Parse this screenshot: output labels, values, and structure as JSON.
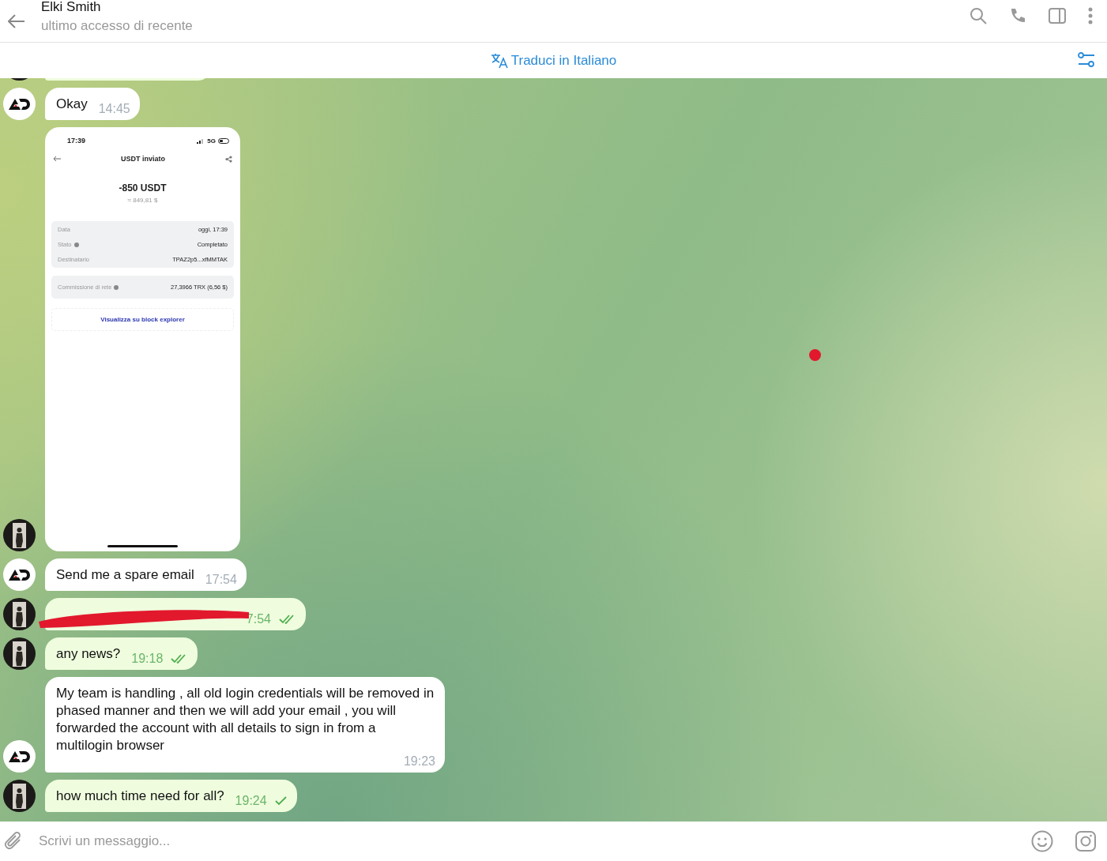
{
  "header": {
    "title": "Elki Smith",
    "status": "ultimo accesso di recente"
  },
  "translate_bar": {
    "label": "Traduci in Italiano"
  },
  "messages": [
    {
      "kind": "fragment",
      "outgoing": true
    },
    {
      "kind": "text",
      "outgoing": false,
      "text": "Okay",
      "time": "14:45"
    },
    {
      "kind": "screenshot",
      "outgoing": true,
      "screenshot": {
        "clock": "17:39",
        "network": "5G",
        "title": "USDT inviato",
        "amount": "-850 USDT",
        "fiat": "≈ 849,81 $",
        "details": [
          {
            "label": "Data",
            "value": "oggi, 17:39",
            "info": false
          },
          {
            "label": "Stato",
            "value": "Completato",
            "info": true
          },
          {
            "label": "Destinatario",
            "value": "TPAZ2p5...xfMMTAK",
            "info": false
          }
        ],
        "fee": {
          "label": "Commissione di rete",
          "value": "27,3966 TRX (6,56 $)",
          "info": true
        },
        "link": "Visualizza su block explorer"
      }
    },
    {
      "kind": "text",
      "outgoing": false,
      "text": "Send me a spare email",
      "time": "17:54"
    },
    {
      "kind": "redacted",
      "outgoing": true,
      "time": "7:54",
      "read": true
    },
    {
      "kind": "text",
      "outgoing": true,
      "text": "any news?",
      "time": "19:18",
      "read": true
    },
    {
      "kind": "text",
      "outgoing": false,
      "text": "My team is handling , all old login credentials will be removed in phased manner and then we will add your email , you will forwarded the account with all details to sign in from a multilogin browser",
      "time": "19:23"
    },
    {
      "kind": "text",
      "outgoing": true,
      "text": "how much time need for all?",
      "time": "19:24",
      "read": false
    }
  ],
  "composer": {
    "placeholder": "Scrivi un messaggio..."
  }
}
